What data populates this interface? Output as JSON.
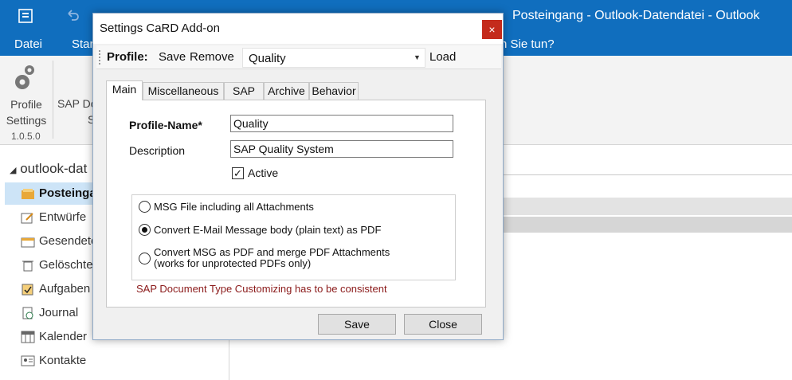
{
  "outlook": {
    "window_title": "Posteingang - Outlook-Datendatei - Outlook",
    "menu": {
      "file": "Datei",
      "start": "Star",
      "tell_me": "n Sie tun?"
    },
    "ribbon": {
      "profile_settings_1": "Profile",
      "profile_settings_2": "Settings",
      "sap_doc_1": "SAP Do",
      "sap_doc_2": "S",
      "version": "1.0.5.0"
    },
    "folders": {
      "root": "outlook-dat",
      "items": [
        {
          "label": "Posteinga",
          "icon": "inbox-icon"
        },
        {
          "label": "Entwürfe",
          "icon": "drafts-icon"
        },
        {
          "label": "Gesendete",
          "icon": "sent-icon"
        },
        {
          "label": "Gelöschte",
          "icon": "trash-icon"
        },
        {
          "label": "Aufgaben",
          "icon": "tasks-icon"
        },
        {
          "label": "Journal",
          "icon": "journal-icon"
        },
        {
          "label": "Kalender",
          "icon": "calendar-icon"
        },
        {
          "label": "Kontakte",
          "icon": "contacts-icon"
        }
      ]
    },
    "accent": "#106ebe"
  },
  "dialog": {
    "title": "Settings CaRD Add-on",
    "close_glyph": "×",
    "toolbar": {
      "profile_label": "Profile:",
      "save": "Save",
      "remove": "Remove",
      "profile_value": "Quality",
      "dropdown_arrow": "▼",
      "load": "Load"
    },
    "tabs": [
      "Main",
      "Miscellaneous",
      "SAP",
      "Archive",
      "Behavior"
    ],
    "main": {
      "profile_name_label": "Profile-Name*",
      "profile_name_value": "Quality",
      "description_label": "Description",
      "description_value": "SAP Quality System",
      "active_label": "Active",
      "active_checked": true,
      "check_glyph": "✓",
      "options": {
        "opt1": "MSG File including all Attachments",
        "opt2": "Convert E-Mail Message body (plain text) as PDF",
        "opt3_line1": "Convert MSG as PDF and merge PDF Attachments",
        "opt3_line2": "(works for unprotected PDFs only)",
        "selected": 2
      },
      "warning": "SAP Document Type Customizing has to be consistent",
      "warning_color": "#8b1a1a"
    },
    "buttons": {
      "save": "Save",
      "close": "Close"
    }
  }
}
